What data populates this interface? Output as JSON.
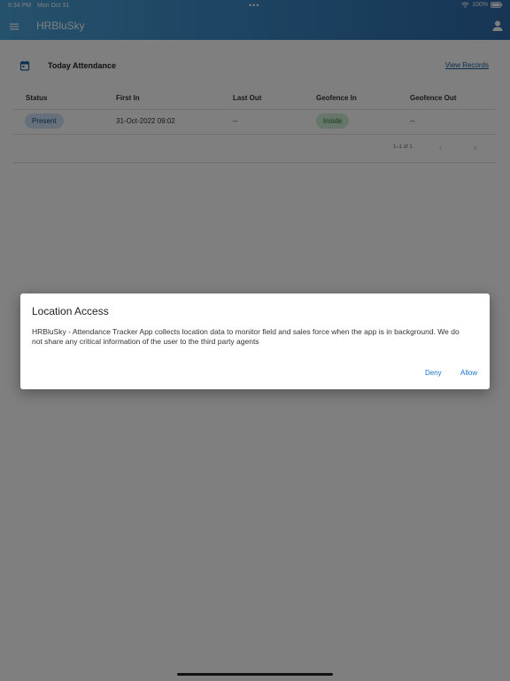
{
  "status_bar": {
    "time": "6:34 PM",
    "date": "Mon Oct 31",
    "dots": "•••",
    "battery": "100%"
  },
  "app_bar": {
    "title": "HRBluSky"
  },
  "attendance_card": {
    "title": "Today Attendance",
    "view_records": "View Records",
    "columns": [
      "Status",
      "First In",
      "Last Out",
      "Geofence In",
      "Geofence Out"
    ],
    "row": {
      "status": "Present",
      "first_in": "31-Oct-2022 09:02",
      "last_out": "--",
      "geofence_in": "Inside",
      "geofence_out": "--"
    },
    "pagination": {
      "text": "1–1 of 1",
      "prev": "‹",
      "next": "›"
    }
  },
  "dialog": {
    "title": "Location Access",
    "message": "HRBluSky - Attendance Tracker App collects location data to monitor field and sales force when the app is in background. We do not share any critical information of the user to the third party agents",
    "deny_label": "Deny",
    "allow_label": "Allow"
  },
  "colors": {
    "header_gradient_start": "#4aa3d8",
    "header_gradient_end": "#2f6aa8",
    "link": "#1a5fa0",
    "dialog_button": "#1a73c9",
    "chip_present_bg": "#cfe3f7",
    "chip_inside_bg": "#cdeed2"
  },
  "icons": {
    "menu": "hamburger-menu-icon",
    "account": "account-icon",
    "calendar": "calendar-icon",
    "wifi": "wifi-icon",
    "battery": "battery-icon"
  }
}
